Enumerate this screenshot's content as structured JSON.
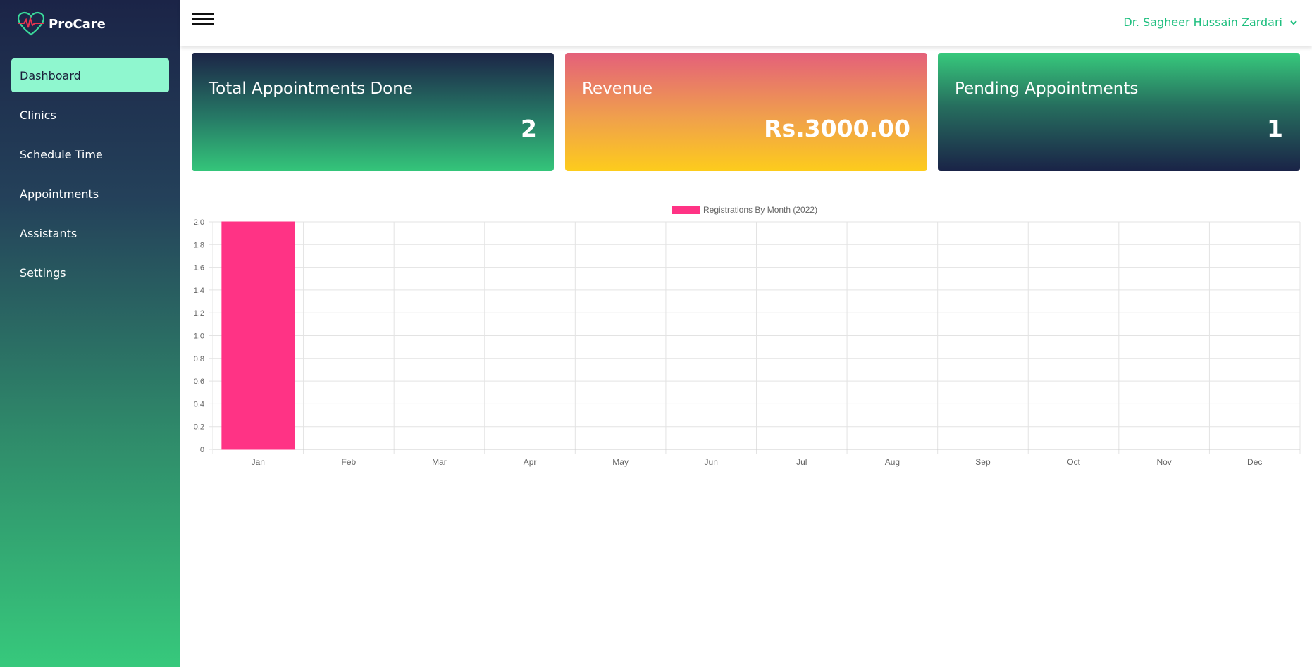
{
  "app": {
    "brand_name": "ProCare",
    "logo_icon": "heart-pulse-icon"
  },
  "colors": {
    "accent": "#1fbf7f",
    "active_nav_bg": "#8ff7cf",
    "bar_color": "#ff3385"
  },
  "sidebar": {
    "items": [
      {
        "label": "Dashboard",
        "active": true
      },
      {
        "label": "Clinics",
        "active": false
      },
      {
        "label": "Schedule Time",
        "active": false
      },
      {
        "label": "Appointments",
        "active": false
      },
      {
        "label": "Assistants",
        "active": false
      },
      {
        "label": "Settings",
        "active": false
      }
    ]
  },
  "topbar": {
    "menu_icon": "hamburger-menu-icon",
    "user_name": "Dr. Sagheer Hussain Zardari",
    "user_dropdown_icon": "chevron-down-icon"
  },
  "cards": [
    {
      "title": "Total Appointments Done",
      "value": "2"
    },
    {
      "title": "Revenue",
      "value": "Rs.3000.00"
    },
    {
      "title": "Pending Appointments",
      "value": "1"
    }
  ],
  "chart_data": {
    "type": "bar",
    "categories": [
      "Jan",
      "Feb",
      "Mar",
      "Apr",
      "May",
      "Jun",
      "Jul",
      "Aug",
      "Sep",
      "Oct",
      "Nov",
      "Dec"
    ],
    "series": [
      {
        "name": "Registrations By Month (2022)",
        "values": [
          2,
          0,
          0,
          0,
          0,
          0,
          0,
          0,
          0,
          0,
          0,
          0
        ],
        "color": "#ff3385"
      }
    ],
    "ylim": [
      0,
      2.0
    ],
    "yticks": [
      "0",
      "0.2",
      "0.4",
      "0.6",
      "0.8",
      "1.0",
      "1.2",
      "1.4",
      "1.6",
      "1.8",
      "2.0"
    ],
    "grid": true,
    "legend_position": "top-center"
  }
}
